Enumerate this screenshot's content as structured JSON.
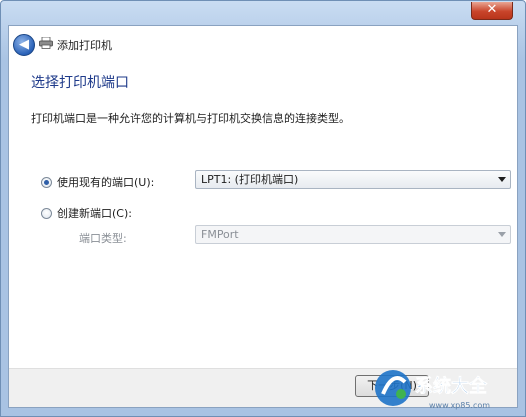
{
  "window": {
    "title": "添加打印机",
    "close_glyph": "✕"
  },
  "nav": {
    "back_glyph": "◀"
  },
  "page": {
    "heading": "选择打印机端口",
    "description": "打印机端口是一种允许您的计算机与打印机交换信息的连接类型。"
  },
  "options": {
    "use_existing": {
      "label": "使用现有的端口(U):",
      "selected": true,
      "value": "LPT1: (打印机端口)"
    },
    "create_new": {
      "label": "创建新端口(C):",
      "selected": false,
      "port_type_label": "端口类型:",
      "port_type_value": "FMPort"
    }
  },
  "footer": {
    "next_label": "下一步(N)"
  },
  "watermark": {
    "brand": "系统大全",
    "url": "www.xp85.com"
  },
  "colors": {
    "heading": "#1e3a8a",
    "titlebar": "#a9c3e3",
    "close_button": "#c9452b"
  }
}
